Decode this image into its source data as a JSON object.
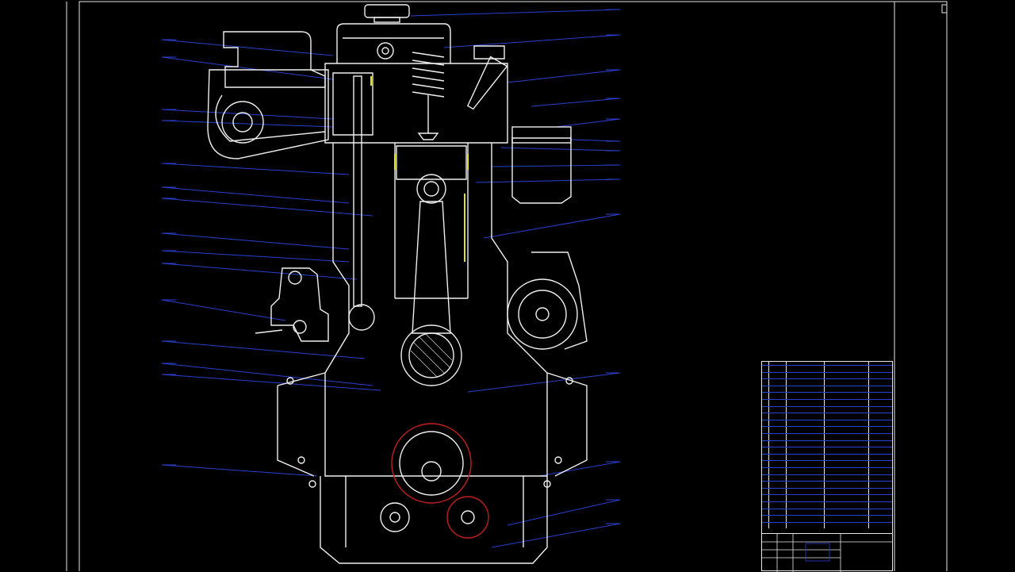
{
  "drawing": {
    "colors": {
      "background": "#000000",
      "outline": "#f0f0f0",
      "leader": "#2a3fd0",
      "accent_yellow": "#e0e020",
      "accent_red": "#c02020"
    },
    "left_callouts": [
      "",
      "",
      "",
      "",
      "",
      "",
      "",
      "",
      "",
      "",
      "",
      "",
      "",
      "",
      "",
      "",
      ""
    ],
    "right_callouts": [
      "",
      "",
      "",
      "",
      "",
      "",
      "",
      "",
      "",
      "",
      "",
      "",
      "",
      "",
      "",
      ""
    ]
  },
  "parts_list": {
    "rows": [
      "",
      "",
      "",
      "",
      "",
      "",
      "",
      "",
      "",
      "",
      "",
      "",
      "",
      "",
      "",
      "",
      "",
      "",
      "",
      "",
      "",
      "",
      "",
      ""
    ]
  },
  "title_block": {
    "title": ""
  }
}
